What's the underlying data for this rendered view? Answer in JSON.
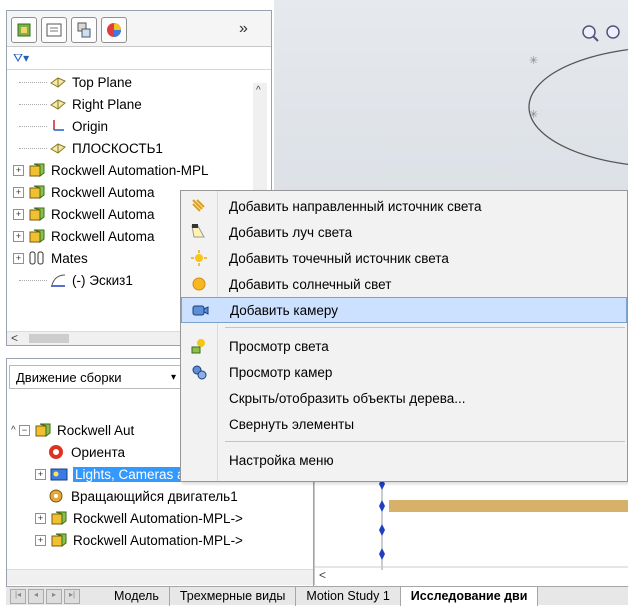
{
  "feature_tree": {
    "items": [
      {
        "label": "Top Plane",
        "icon": "plane-icon",
        "expandable": false
      },
      {
        "label": "Right Plane",
        "icon": "plane-icon",
        "expandable": false
      },
      {
        "label": "Origin",
        "icon": "origin-icon",
        "expandable": false
      },
      {
        "label": "ПЛОСКОСТЬ1",
        "icon": "plane-icon",
        "expandable": false
      },
      {
        "label": "Rockwell Automation-MPL",
        "icon": "assembly-icon",
        "expandable": true
      },
      {
        "label": "Rockwell Automa",
        "icon": "assembly-icon",
        "expandable": true
      },
      {
        "label": "Rockwell Automa",
        "icon": "assembly-icon",
        "expandable": true
      },
      {
        "label": "Rockwell Automa",
        "icon": "assembly-icon",
        "expandable": true
      },
      {
        "label": "Mates",
        "icon": "mates-icon",
        "expandable": true
      },
      {
        "label": "(-) Эскиз1",
        "icon": "sketch-icon",
        "expandable": false
      }
    ]
  },
  "motion": {
    "study_type": "Движение сборки",
    "tree": [
      {
        "label": "Rockwell Aut",
        "icon": "assembly-icon",
        "indent": 0,
        "expandable": true,
        "selected": false
      },
      {
        "label": "Ориента",
        "icon": "orientation-icon",
        "indent": 1,
        "expandable": false,
        "selected": false
      },
      {
        "label": "Lights, Cameras and Scene",
        "icon": "lights-cameras-icon",
        "indent": 1,
        "expandable": true,
        "selected": true
      },
      {
        "label": "Вращающийся двигатель1",
        "icon": "rotary-motor-icon",
        "indent": 1,
        "expandable": false,
        "selected": false
      },
      {
        "label": "Rockwell Automation-MPL->",
        "icon": "assembly-icon",
        "indent": 1,
        "expandable": true,
        "selected": false
      },
      {
        "label": "Rockwell Automation-MPL->",
        "icon": "assembly-icon",
        "indent": 1,
        "expandable": true,
        "selected": false
      }
    ]
  },
  "context_menu": {
    "items": [
      {
        "label": "Добавить направленный источник света",
        "icon": "directional-light-icon"
      },
      {
        "label": "Добавить луч света",
        "icon": "spot-light-icon"
      },
      {
        "label": "Добавить точечный источник света",
        "icon": "point-light-icon"
      },
      {
        "label": "Добавить солнечный свет",
        "icon": "sunlight-icon"
      },
      {
        "label": "Добавить камеру",
        "icon": "camera-icon",
        "hover": true
      },
      {
        "label": "Просмотр света",
        "icon": "view-lights-icon",
        "separator_before": true
      },
      {
        "label": "Просмотр камер",
        "icon": "view-cameras-icon"
      },
      {
        "label": "Скрыть/отобразить объекты дерева...",
        "icon": ""
      },
      {
        "label": "Свернуть элементы",
        "icon": ""
      },
      {
        "label": "Настройка меню",
        "icon": "",
        "separator_before": true
      }
    ]
  },
  "bottom_tabs": [
    "Модель",
    "Трехмерные виды",
    "Motion Study 1",
    "Исследование дви"
  ],
  "active_tab": "Исследование дви",
  "colors": {
    "selection": "#3399ff",
    "menu_hover": "#cce0ff",
    "timeline_bar": "#d7b06a",
    "key_point": "#1f3fbf"
  }
}
